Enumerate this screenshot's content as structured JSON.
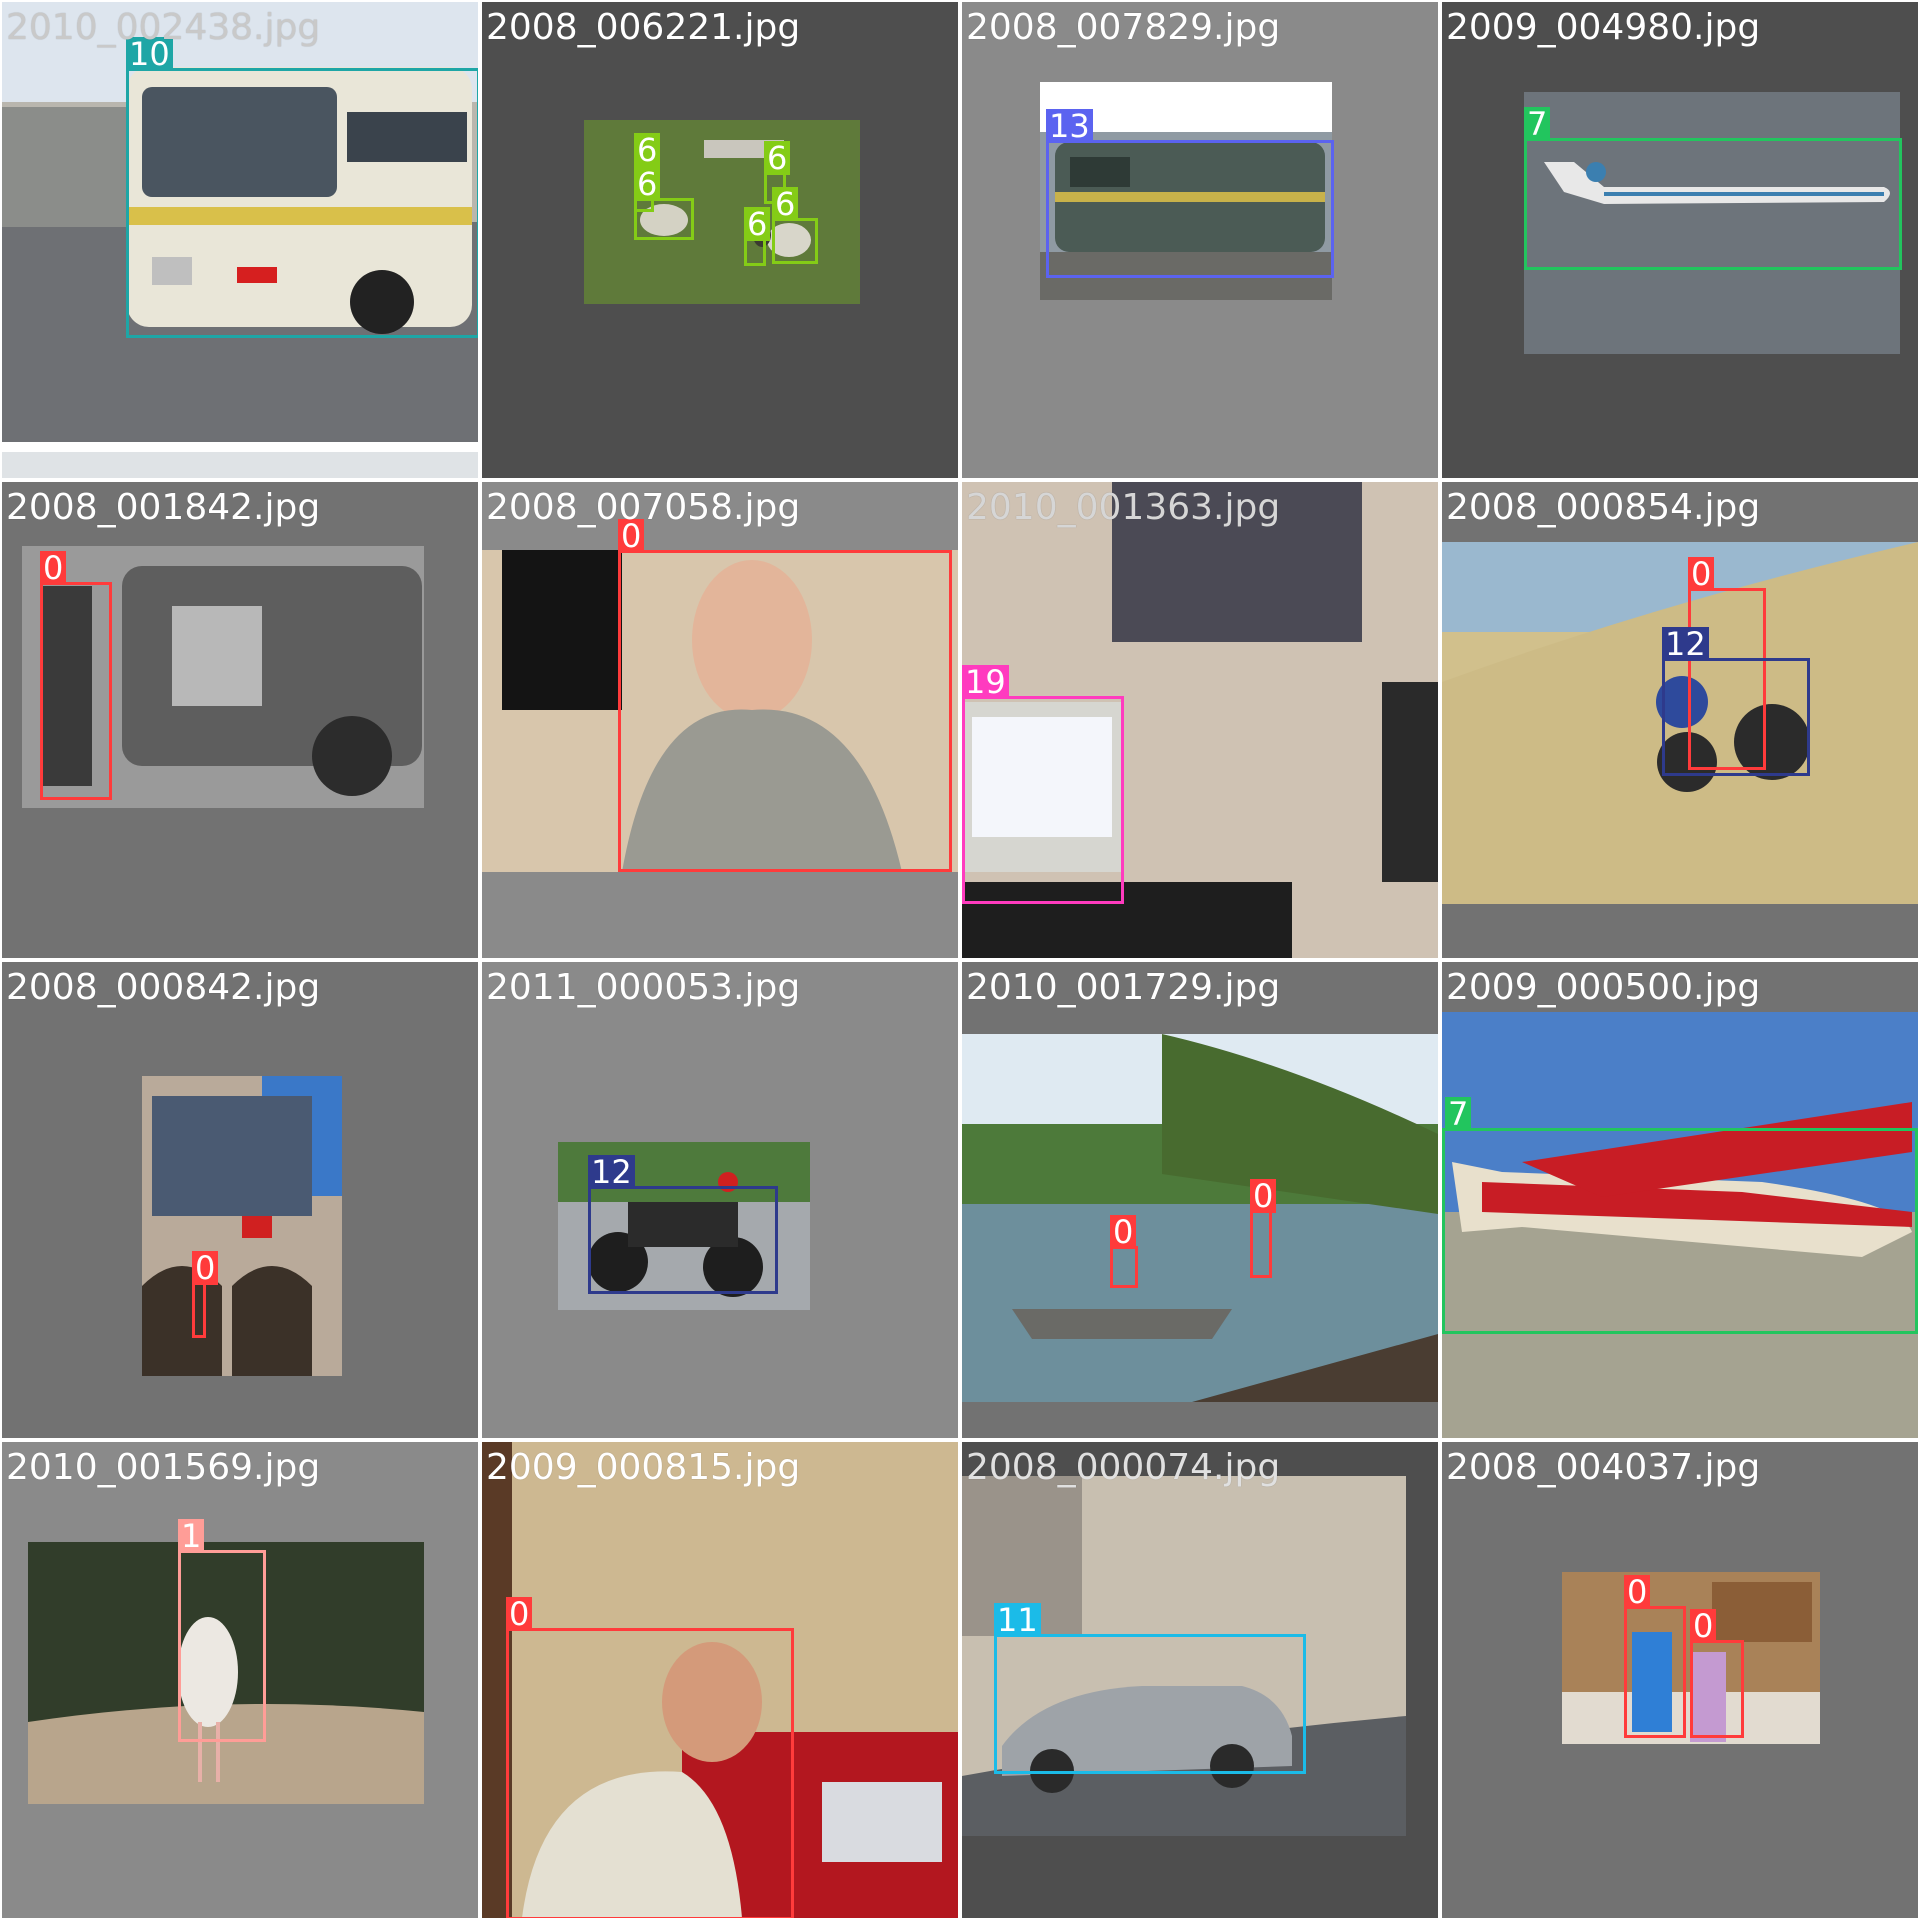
{
  "title": "",
  "class_colors": {
    "0": "#ff3b3b",
    "1": "#ff9d97",
    "6": "#84cc16",
    "7": "#22c55e",
    "10": "#1ea6a6",
    "11": "#1bbbe8",
    "12": "#2e3a8c",
    "13": "#5b63f0",
    "19": "#ff3bbf"
  },
  "tiles": [
    {
      "filename": "2010_002438.jpg",
      "labels": [
        "10"
      ]
    },
    {
      "filename": "2008_006221.jpg",
      "labels": [
        "6",
        "6",
        "6",
        "6",
        "6"
      ]
    },
    {
      "filename": "2008_007829.jpg",
      "labels": [
        "13"
      ]
    },
    {
      "filename": "2009_004980.jpg",
      "labels": [
        "7"
      ]
    },
    {
      "filename": "2008_001842.jpg",
      "labels": [
        "0"
      ]
    },
    {
      "filename": "2008_007058.jpg",
      "labels": [
        "0"
      ]
    },
    {
      "filename": "2010_001363.jpg",
      "labels": [
        "19"
      ]
    },
    {
      "filename": "2008_000854.jpg",
      "labels": [
        "0",
        "12"
      ]
    },
    {
      "filename": "2008_000842.jpg",
      "labels": [
        "0"
      ]
    },
    {
      "filename": "2011_000053.jpg",
      "labels": [
        "12"
      ]
    },
    {
      "filename": "2010_001729.jpg",
      "labels": [
        "0",
        "0"
      ]
    },
    {
      "filename": "2009_000500.jpg",
      "labels": [
        "7"
      ]
    },
    {
      "filename": "2010_001569.jpg",
      "labels": [
        "1"
      ]
    },
    {
      "filename": "2009_000815.jpg",
      "labels": [
        "0"
      ]
    },
    {
      "filename": "2008_000074.jpg",
      "labels": [
        "11"
      ]
    },
    {
      "filename": "2008_004037.jpg",
      "labels": [
        "0",
        "0"
      ]
    }
  ]
}
